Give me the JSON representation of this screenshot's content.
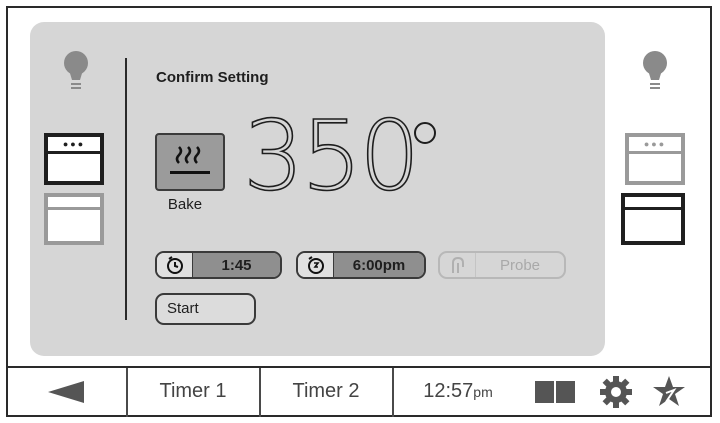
{
  "panel": {
    "title": "Confirm Setting",
    "mode_label": "Bake",
    "temperature": "350",
    "cook_time": "1:45",
    "end_time": "6:00pm",
    "probe_label": "Probe",
    "start_label": "Start"
  },
  "left_oven": {
    "light_icon": "lightbulb-icon",
    "upper": "selected",
    "lower": "unselected"
  },
  "right_oven": {
    "light_icon": "lightbulb-icon",
    "upper": "unselected",
    "lower": "selected"
  },
  "bottom_bar": {
    "back_icon": "back-arrow-icon",
    "timer1_label": "Timer 1",
    "timer2_label": "Timer 2",
    "clock_time": "12:57",
    "clock_ampm": "pm",
    "icons": [
      "split-view-icon",
      "gear-icon",
      "favorite-star-icon"
    ]
  },
  "colors": {
    "panel_bg": "#d6d6d6",
    "selected_value_bg": "#8f8f8f",
    "disabled": "#a9a9a9"
  }
}
